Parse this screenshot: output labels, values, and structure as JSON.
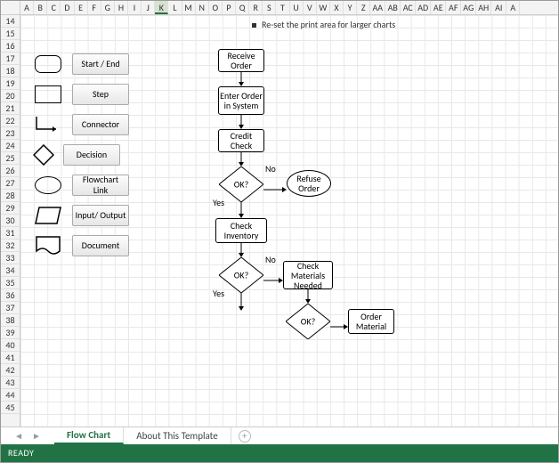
{
  "note": "Re-set the print area for larger charts",
  "columns": [
    "A",
    "B",
    "C",
    "D",
    "E",
    "F",
    "G",
    "H",
    "I",
    "J",
    "K",
    "L",
    "M",
    "N",
    "O",
    "P",
    "Q",
    "R",
    "S",
    "T",
    "U",
    "V",
    "W",
    "X",
    "Y",
    "Z",
    "AA",
    "AB",
    "AC",
    "AD",
    "AE",
    "AF",
    "AG",
    "AH",
    "AI",
    "A"
  ],
  "rows": [
    "14",
    "15",
    "16",
    "17",
    "18",
    "19",
    "20",
    "21",
    "22",
    "23",
    "24",
    "25",
    "26",
    "27",
    "28",
    "29",
    "30",
    "31",
    "32",
    "33",
    "34",
    "35",
    "36",
    "37",
    "38",
    "39",
    "40",
    "41",
    "42",
    "43",
    "44",
    "45"
  ],
  "selected_col": "K",
  "legend": {
    "start_end": "Start / End",
    "step": "Step",
    "connector": "Connector",
    "decision": "Decision",
    "link": "Flowchart Link",
    "io": "Input/ Output",
    "document": "Document"
  },
  "flow": {
    "receive": "Receive Order",
    "enter": "Enter Order in System",
    "credit": "Credit Check",
    "ok": "OK?",
    "refuse": "Refuse Order",
    "inventory": "Check Inventory",
    "materials": "Check Materials Needed",
    "order_material": "Order Material",
    "yes": "Yes",
    "no": "No"
  },
  "tabs": {
    "active": "Flow Chart",
    "other": "About This Template"
  },
  "status": "READY"
}
